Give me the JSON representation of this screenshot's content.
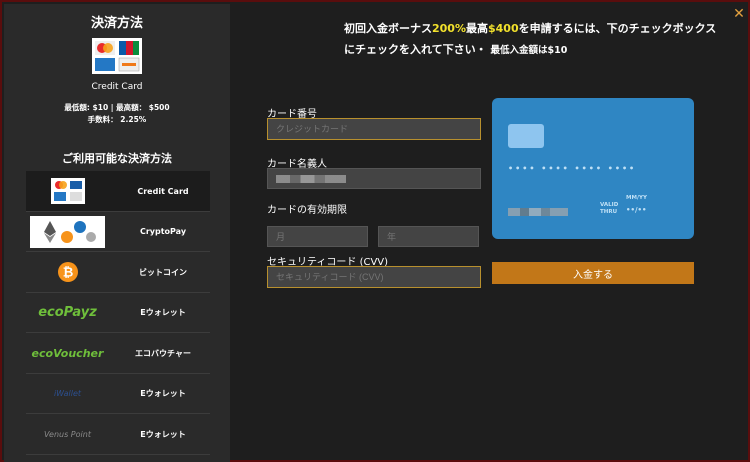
{
  "sidebar": {
    "title": "決済方法",
    "selected_name": "Credit Card",
    "limits": "最低額: $10 | 最高額： $500",
    "fee": "手数料： 2.25%",
    "subtitle": "ご利用可能な決済方法",
    "methods": [
      {
        "label": "Credit Card",
        "logo": "credit-card-logos",
        "active": true
      },
      {
        "label": "CryptoPay",
        "logo": "crypto-logos"
      },
      {
        "label": "ビットコイン",
        "logo": "bitcoin-icon"
      },
      {
        "label": "Eウォレット",
        "logo_text": "ecoPayz"
      },
      {
        "label": "エコバウチャー",
        "logo_text": "ecoVoucher"
      },
      {
        "label": "Eウォレット",
        "logo_text": "iWallet"
      },
      {
        "label": "Eウォレット",
        "logo_text": "Venus Point"
      }
    ]
  },
  "bonus": {
    "part1": "初回入金ボーナス",
    "pct": "200%",
    "part2": "最高",
    "amount": "$400",
    "part3": "を申請するには、下のチェックボックス",
    "line2": "にチェックを入れて下さい・",
    "min": "最低入金額は$10"
  },
  "form": {
    "card_number_label": "カード番号",
    "card_number_placeholder": "クレジットカード",
    "holder_label": "カード名義人",
    "expiry_label": "カードの有効期限",
    "month_placeholder": "月",
    "year_placeholder": "年",
    "cvv_label": "セキュリティコード (CVV)",
    "cvv_placeholder": "セキュリティコード (CVV)",
    "submit_label": "入金する"
  },
  "card_preview": {
    "number_mask": "•••• •••• •••• ••••",
    "valid_label": "VALID THRU",
    "mmyy_label": "MM/YY",
    "expiry_mask": "••/••"
  },
  "colors": {
    "accent": "#c27718",
    "highlight": "#f2e12c",
    "card_blue": "#2f86c3",
    "close": "#e2a03f"
  },
  "close_icon": "close-icon"
}
